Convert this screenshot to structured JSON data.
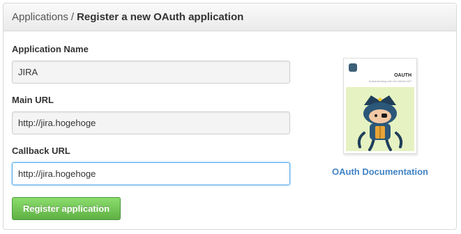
{
  "breadcrumb": {
    "parent": "Applications",
    "separator": "/",
    "current": "Register a new OAuth application"
  },
  "form": {
    "app_name": {
      "label": "Application Name",
      "value": "JIRA"
    },
    "main_url": {
      "label": "Main URL",
      "value": "http://jira.hogehoge"
    },
    "callback_url": {
      "label": "Callback URL",
      "value": "http://jira.hogehoge"
    },
    "submit_label": "Register application"
  },
  "sidebar": {
    "book_title": "OAUTH",
    "book_subtitle": "Authenticating with the GitHub API",
    "doc_link": "OAuth Documentation"
  },
  "colors": {
    "link": "#4183c4",
    "button_green": "#60b044",
    "focus_border": "#51a7e8"
  }
}
